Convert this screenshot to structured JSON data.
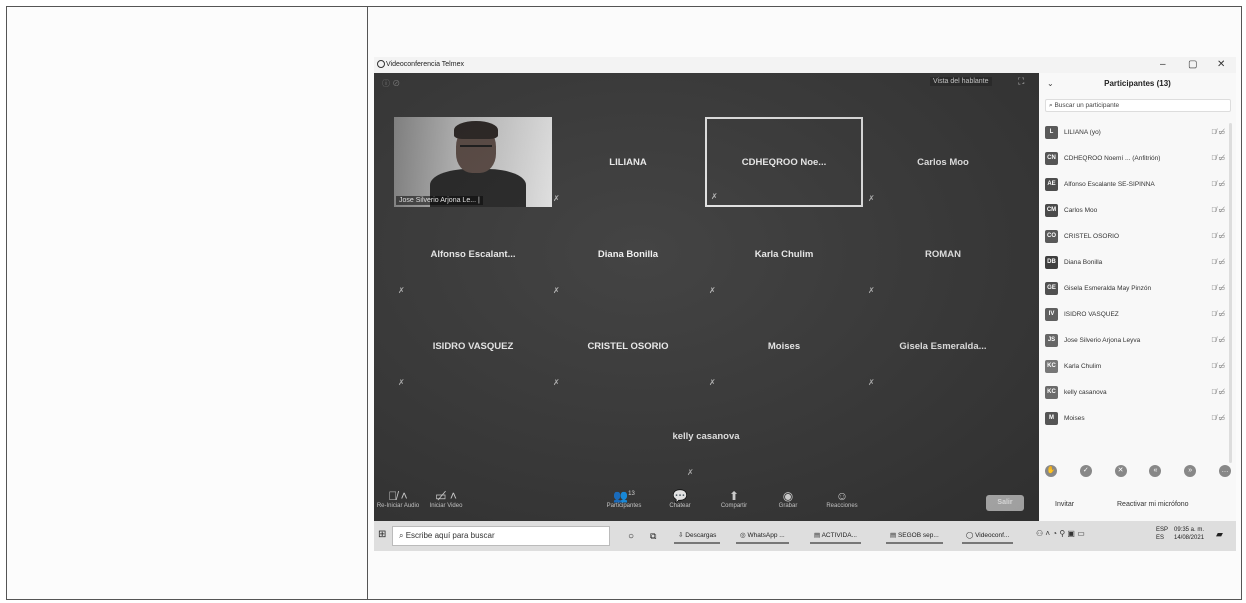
{
  "window": {
    "title": "Videoconferencia Telmex",
    "minimize": "–",
    "maximize": "▢",
    "close": "✕"
  },
  "meeting": {
    "top_icons": "ⓘ ⊘",
    "speaker_view_label": "Vista del hablante",
    "fullscreen_icon": "⛶",
    "tiles": [
      {
        "name": "Jose Silverio Arjona Le... |",
        "video": true
      },
      {
        "name": "LILIANA"
      },
      {
        "name": "CDHEQROO Noe...",
        "active": true
      },
      {
        "name": "Carlos Moo"
      },
      {
        "name": "Alfonso Escalant..."
      },
      {
        "name": "Diana Bonilla"
      },
      {
        "name": "Karla Chulim"
      },
      {
        "name": "ROMAN"
      },
      {
        "name": "ISIDRO VASQUEZ"
      },
      {
        "name": "CRISTEL OSORIO"
      },
      {
        "name": "Moises"
      },
      {
        "name": "Gisela Esmeralda..."
      },
      {
        "name": "kelly casanova"
      }
    ],
    "toolbar": {
      "audio": "Re-Iniciar Audio",
      "video": "Iniciar Video",
      "participants": "Participantes",
      "participants_count": "13",
      "chat": "Chatear",
      "share": "Compartir",
      "record": "Grabar",
      "reactions": "Reacciones",
      "leave": "Salir"
    }
  },
  "panel": {
    "title": "Participantes (13)",
    "search_placeholder": "Buscar un participante",
    "participants": [
      {
        "initials": "L",
        "name": "LILIANA (yo)",
        "color": "#5a5a5a"
      },
      {
        "initials": "CN",
        "name": "CDHEQROO Noemí ... (Anfitrión)",
        "color": "#555555"
      },
      {
        "initials": "AE",
        "name": "Alfonso Escalante SE-SIPINNA",
        "color": "#4d4d4d"
      },
      {
        "initials": "CM",
        "name": "Carlos Moo",
        "color": "#4a4a4a"
      },
      {
        "initials": "CO",
        "name": "CRISTEL OSORIO",
        "color": "#595959"
      },
      {
        "initials": "DB",
        "name": "Diana Bonilla",
        "color": "#3f3f3f"
      },
      {
        "initials": "GE",
        "name": "Gisela Esmeralda May Pinzón",
        "color": "#505050"
      },
      {
        "initials": "IV",
        "name": "ISIDRO VASQUEZ",
        "color": "#5f5f5f"
      },
      {
        "initials": "JS",
        "name": "Jose Silverio Arjona Leyva",
        "color": "#666666"
      },
      {
        "initials": "KC",
        "name": "Karla Chulim",
        "color": "#777777"
      },
      {
        "initials": "KC",
        "name": "kelly casanova",
        "color": "#6b6b6b"
      },
      {
        "initials": "M",
        "name": "Moises",
        "color": "#555555"
      }
    ],
    "invite_label": "Invitar",
    "unmute_label": "Reactivar mi micrófono"
  },
  "taskbar": {
    "search_placeholder": "Escribe aquí para buscar",
    "apps": [
      "Descargas",
      "WhatsApp ...",
      "ACTIVIDA...",
      "SEGOB sep...",
      "Videoconf..."
    ],
    "lang_top": "ESP",
    "lang_bottom": "ES",
    "time": "09:35 a. m.",
    "date": "14/08/2021"
  }
}
